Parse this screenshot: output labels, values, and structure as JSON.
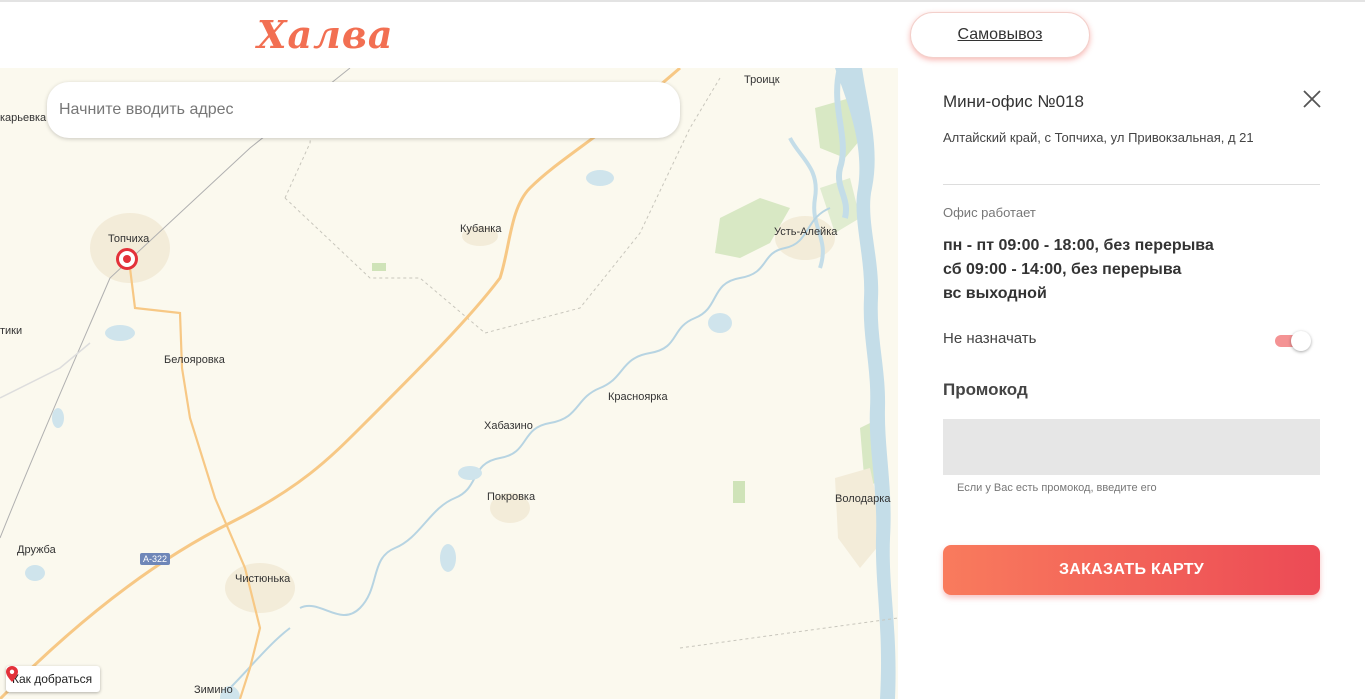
{
  "header": {
    "logo_text": "Халва",
    "pickup_label": "Самовывоз"
  },
  "map": {
    "search_placeholder": "Начните вводить адрес",
    "route_label": "Как добраться",
    "road_badge": "А-322",
    "places": [
      {
        "id": "karyevka",
        "label": "карьевка"
      },
      {
        "id": "troitsk",
        "label": "Троицк"
      },
      {
        "id": "topchiha",
        "label": "Топчиха"
      },
      {
        "id": "kubanka",
        "label": "Кубанка"
      },
      {
        "id": "ust-aleyka",
        "label": "Усть-Алейка"
      },
      {
        "id": "tiki",
        "label": "тики"
      },
      {
        "id": "beloyarovka",
        "label": "Белояровка"
      },
      {
        "id": "krasnoyarka",
        "label": "Красноярка"
      },
      {
        "id": "khabazino",
        "label": "Хабазино"
      },
      {
        "id": "pokrovka",
        "label": "Покровка"
      },
      {
        "id": "volodarka",
        "label": "Володарка"
      },
      {
        "id": "druzhba",
        "label": "Дружба"
      },
      {
        "id": "chistyunka",
        "label": "Чистюнька"
      },
      {
        "id": "zimino",
        "label": "Зимино"
      }
    ]
  },
  "panel": {
    "office_title": "Мини-офис №018",
    "address": "Алтайский край, с Топчиха, ул Привокзальная, д 21",
    "works_label": "Офис работает",
    "hours": [
      "пн - пт 09:00 - 18:00, без перерыва",
      "сб 09:00 - 14:00, без перерыва",
      "вс выходной"
    ],
    "toggle_label": "Не назначать",
    "toggle_on": true,
    "promo_label": "Промокод",
    "promo_value": "",
    "promo_hint": "Если у Вас есть промокод, введите его",
    "order_button": "ЗАКАЗАТЬ КАРТУ"
  },
  "colors": {
    "brand": "#f26f52",
    "button_gradient_start": "#f97b5d",
    "button_gradient_end": "#ec4a55",
    "marker": "#e3313a",
    "toggle_track": "#f49394"
  }
}
